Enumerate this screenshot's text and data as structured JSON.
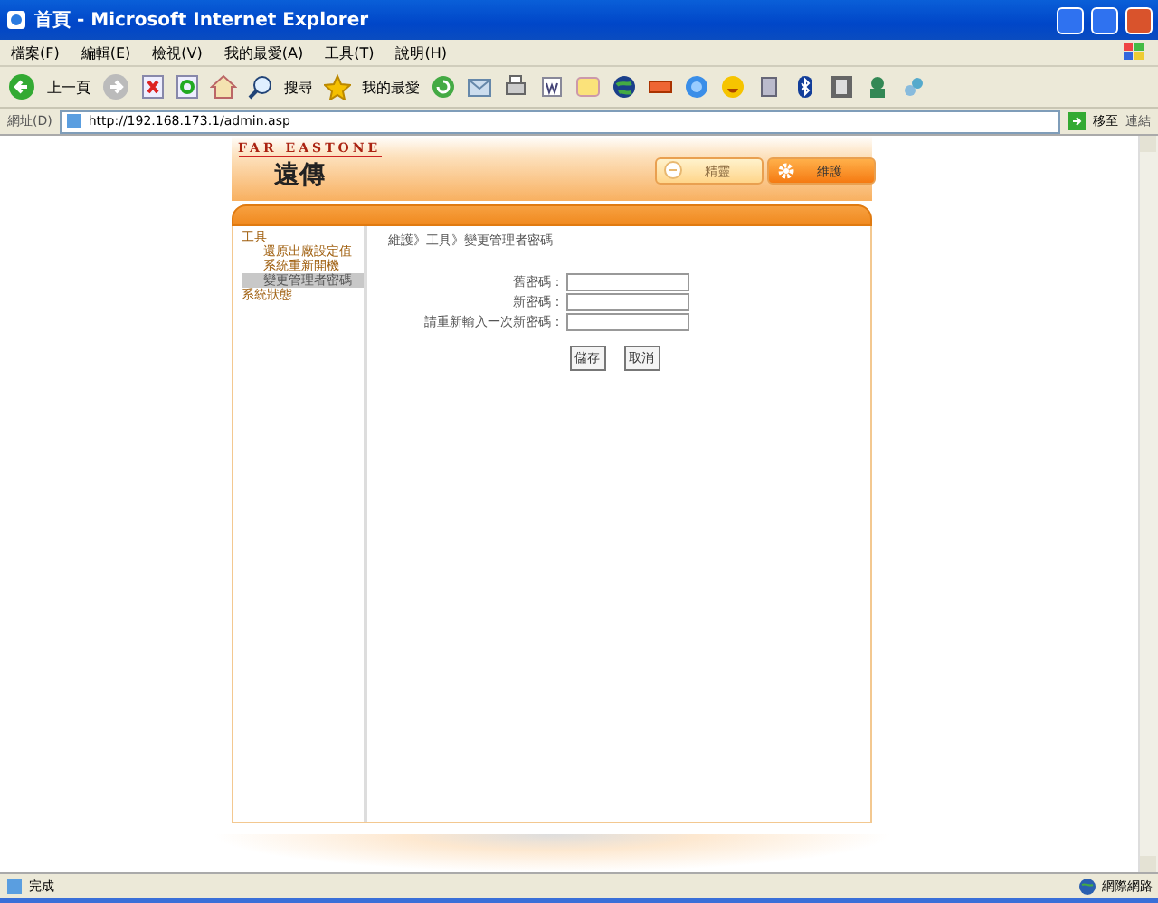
{
  "window": {
    "title": "首頁 - Microsoft Internet Explorer"
  },
  "menu": [
    "檔案(F)",
    "編輯(E)",
    "檢視(V)",
    "我的最愛(A)",
    "工具(T)",
    "說明(H)"
  ],
  "toolbar": {
    "back": "上一頁",
    "search": "搜尋",
    "favorites": "我的最愛"
  },
  "address": {
    "label": "網址(D)",
    "value": "http://192.168.173.1/admin.asp",
    "go": "移至",
    "links": "連結"
  },
  "page": {
    "brand": "FAR EASTONE",
    "brand_name": "遠傳",
    "top_buttons": [
      {
        "label": "精靈",
        "kind": "wizard",
        "disabled": true
      },
      {
        "label": "維護",
        "kind": "gear",
        "disabled": false
      }
    ],
    "sidebar": [
      {
        "label": "工具",
        "children": [
          {
            "label": "還原出廠設定值",
            "selected": false
          },
          {
            "label": "系統重新開機",
            "selected": false
          },
          {
            "label": "變更管理者密碼",
            "selected": true
          }
        ]
      },
      {
        "label": "系統狀態"
      }
    ],
    "breadcrumb": "維護》工具》變更管理者密碼",
    "fields": [
      {
        "label": "舊密碼："
      },
      {
        "label": "新密碼："
      },
      {
        "label": "請重新輸入一次新密碼："
      }
    ],
    "buttons": [
      "儲存",
      "取消"
    ]
  },
  "status_bar": {
    "text": "完成",
    "zone": "網際網路"
  }
}
